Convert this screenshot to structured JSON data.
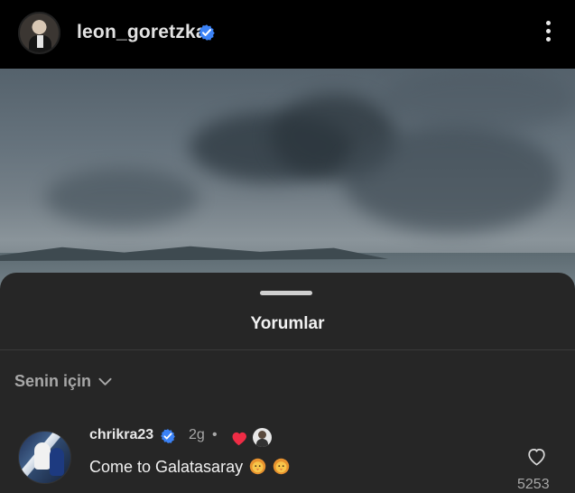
{
  "header": {
    "username": "leon_goretzka",
    "verified": true
  },
  "post": {
    "image_description": "cloudy sky over water"
  },
  "comments_sheet": {
    "title": "Yorumlar",
    "filter_label": "Senin için"
  },
  "comment": {
    "username": "chrikra23",
    "verified": true,
    "time": "2g",
    "separator": "•",
    "text": "Come to Galatasaray",
    "emoji": [
      "lion-face",
      "lion-face"
    ],
    "like_count": "5253",
    "liked_by_author": true
  },
  "colors": {
    "background": "#000000",
    "sheet": "#262626",
    "verified_blue": "#3b82f6",
    "heart_red": "#ef2c45",
    "muted_text": "#a8a8a8"
  }
}
